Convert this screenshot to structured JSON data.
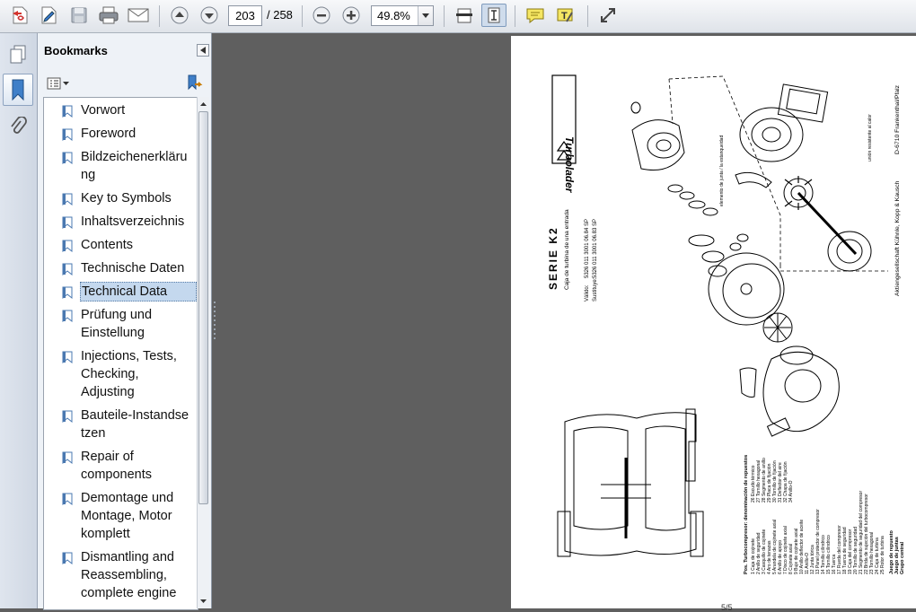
{
  "toolbar": {
    "current_page": "203",
    "page_total": "/ 258",
    "zoom": "49.8%"
  },
  "bookmarks_panel": {
    "title": "Bookmarks"
  },
  "bookmarks": [
    {
      "label": "Vorwort",
      "selected": false
    },
    {
      "label": "Foreword",
      "selected": false
    },
    {
      "label": "Bildzeichenerkläru ng",
      "selected": false
    },
    {
      "label": "Key to Symbols",
      "selected": false
    },
    {
      "label": "Inhaltsverzeichnis",
      "selected": false
    },
    {
      "label": "Contents",
      "selected": false
    },
    {
      "label": "Technische Daten",
      "selected": false
    },
    {
      "label": "Technical Data",
      "selected": true
    },
    {
      "label": "Prüfung und Einstellung",
      "selected": false
    },
    {
      "label": "Injections, Tests, Checking, Adjusting",
      "selected": false
    },
    {
      "label": "Bauteile-Instandse tzen",
      "selected": false
    },
    {
      "label": "Repair of components",
      "selected": false
    },
    {
      "label": "Demontage und Montage, Motor komplett",
      "selected": false
    },
    {
      "label": "Dismantling and Reassembling, complete engine",
      "selected": false
    }
  ],
  "document": {
    "brand": "Turbolader",
    "series": "SERIE K2",
    "subtitle": "Caja de turbina de una entrada",
    "valid_label": "Válido:",
    "valid_value": "5326 011 3001  06.84 SP",
    "replaces_label": "Sustituye:",
    "replaces_value": "5326 011 3001  06.83 SP",
    "company": "Aktiengesellschaft Kühnle, Kopp & Kausch",
    "address": "D-6710 Frankenthal/Pfalz",
    "note_wheel": "unión resistente al calor",
    "note_gasket": "elemento de junta / la estanqueidad",
    "parts_header": "Pos.  Turbocompresor: denominación de repuestos",
    "parts": [
      "1  Caja de cojinete",
      "2  Anillo de seguridad",
      "3  Casquillo de cojinete",
      "4  Aro de tenazas",
      "5  Arandela de cojinete axial",
      "6  Anillo de apoyo",
      "7  Disco de cojinete axial",
      "8  Cojinete axial",
      "9  Buje de cojinete axial",
      "10  Anillo deflector de aceite",
      "11  Anillo-O",
      "12  Junta tórica",
      "13  Panel protector de compresor",
      "14  Tornillo cilíndrico",
      "15  Tornillo cilíndrico",
      "16  Tuerca",
      "17  Rueda del compresor",
      "18  Tuerca de seguridad",
      "19  Caja del compresor",
      "20  Tornillo de seguridad",
      "21  Segmento de seguridad del compresor",
      "22  Brida de sujeción del turbocompresor",
      "23  Tornillo hexagonal",
      "24  Caja de turbina",
      "25  Rotor de turbina",
      "26  Escudo térmico",
      "27  Tornillo hexagonal",
      "28  Segmento de anillo",
      "29  Placa de fijación",
      "30  Tornillo de fijación",
      "31  Deflector del aire",
      "32  Chapa de fijación",
      "34  Anillo-O"
    ],
    "legend": [
      "Juego de repuesto",
      "Juego de juntas",
      "Grupo central"
    ],
    "page_number": "5/5"
  }
}
